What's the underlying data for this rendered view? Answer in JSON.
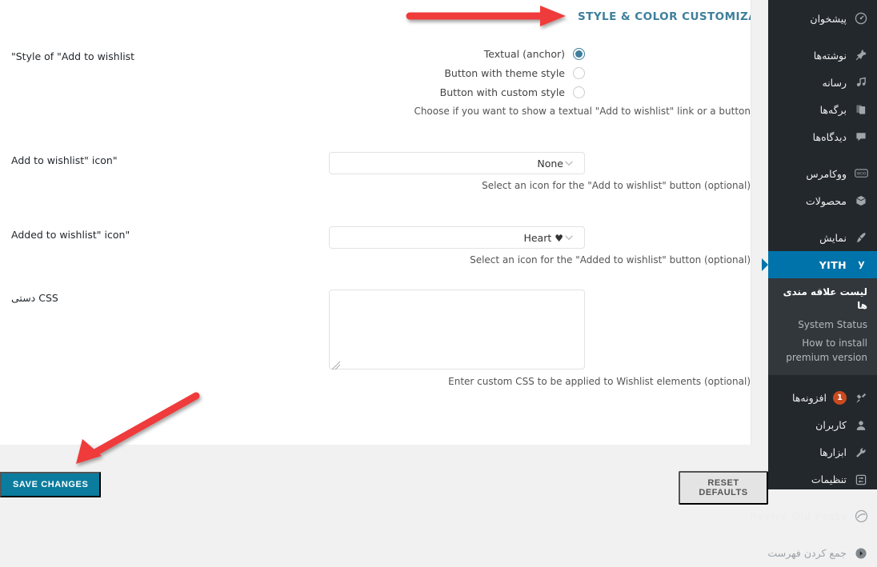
{
  "accent": {
    "title_blue": "#3d7f9c",
    "wp_blue": "#0073aa",
    "save_button": "#0b7c9e",
    "badge_red": "#ca4a1f",
    "arrow_red": "#ef3b3b",
    "menu_bg": "#23282d",
    "submenu_bg": "#32373c"
  },
  "panel": {
    "title": "STYLE & COLOR CUSTOMIZATION"
  },
  "fields": {
    "style": {
      "label": "\"Style of \"Add to wishlist",
      "options": [
        {
          "label": "Textual (anchor)",
          "checked": true
        },
        {
          "label": "Button with theme style",
          "checked": false
        },
        {
          "label": "Button with custom style",
          "checked": false
        }
      ],
      "help": "Choose if you want to show a textual \"Add to wishlist\" link or a button"
    },
    "add_icon": {
      "label": "Add to wishlist\" icon\"",
      "value": "None",
      "chevron": "chevron-down-icon",
      "help": "Select an icon for the \"Add to wishlist\" button (optional)"
    },
    "added_icon": {
      "label": "Added to wishlist\" icon\"",
      "value": "Heart",
      "value_glyph": "♥",
      "chevron": "chevron-down-icon",
      "help": "Select an icon for the \"Added to wishlist\" button (optional)"
    },
    "custom_css": {
      "label": "CSS دستی",
      "value": "",
      "placeholder": "",
      "help": "Enter custom CSS to be applied to Wishlist elements (optional)"
    }
  },
  "footer": {
    "save_label": "SAVE CHANGES",
    "reset_label": "RESET DEFAULTS"
  },
  "sidebar": {
    "items": [
      {
        "label": "پیشخوان",
        "icon": "dashboard-icon",
        "state": "normal",
        "gap": false
      },
      {
        "label": "نوشته‌ها",
        "icon": "pin-icon",
        "state": "normal",
        "gap": true
      },
      {
        "label": "رسانه",
        "icon": "media-icon",
        "state": "normal",
        "gap": false
      },
      {
        "label": "برگه‌ها",
        "icon": "pages-icon",
        "state": "normal",
        "gap": false
      },
      {
        "label": "دیدگاه‌ها",
        "icon": "comment-icon",
        "state": "normal",
        "gap": false
      },
      {
        "label": "ووکامرس",
        "icon": "woo-icon",
        "state": "normal",
        "gap": true
      },
      {
        "label": "محصولات",
        "icon": "product-box-icon",
        "state": "normal",
        "gap": false
      },
      {
        "label": "نمایش",
        "icon": "appearance-brush-icon",
        "state": "normal",
        "gap": true
      },
      {
        "label": "YITH",
        "icon": "yith-icon",
        "state": "current",
        "gap": false
      },
      {
        "label": "افزونه‌ها",
        "icon": "plugins-icon",
        "state": "normal",
        "badge": "1",
        "gap": true
      },
      {
        "label": "کاربران",
        "icon": "users-icon",
        "state": "normal",
        "gap": false
      },
      {
        "label": "ابزارها",
        "icon": "tools-wrench-icon",
        "state": "normal",
        "gap": false
      },
      {
        "label": "تنظیمات",
        "icon": "settings-sliders-icon",
        "state": "normal",
        "gap": false
      },
      {
        "label": "Revive Old Posts",
        "icon": "revive-circle-icon",
        "state": "ltr-plain",
        "gap": true
      },
      {
        "label": "جمع کردن فهرست",
        "icon": "collapse-arrow-icon",
        "state": "dim",
        "gap": true
      }
    ],
    "submenu": [
      {
        "label": "لیست علاقه مندی ها",
        "current": true,
        "ltr": false
      },
      {
        "label": "System Status",
        "current": false,
        "ltr": true
      },
      {
        "label": "How to install premium version",
        "current": false,
        "ltr": true
      }
    ]
  },
  "annotations": [
    {
      "name": "arrow-to-panel-title",
      "type": "arrow-right"
    },
    {
      "name": "arrow-to-save-changes",
      "type": "arrow-down-left"
    }
  ]
}
